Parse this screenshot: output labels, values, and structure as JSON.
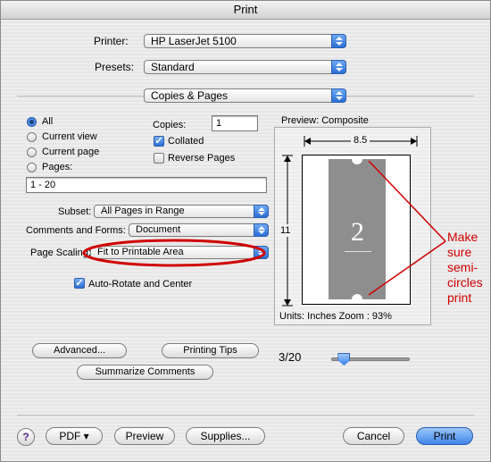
{
  "window": {
    "title": "Print"
  },
  "printer": {
    "label": "Printer:",
    "value": "HP LaserJet 5100"
  },
  "presets": {
    "label": "Presets:",
    "value": "Standard"
  },
  "panel": {
    "value": "Copies & Pages"
  },
  "pages": {
    "all": "All",
    "current_view": "Current view",
    "current_page": "Current page",
    "pages": "Pages:",
    "range_value": "1 - 20",
    "selected": "All"
  },
  "copies": {
    "label": "Copies:",
    "value": "1",
    "collated": "Collated",
    "collated_checked": true,
    "reverse": "Reverse Pages",
    "reverse_checked": false
  },
  "subset": {
    "label": "Subset:",
    "value": "All Pages in Range"
  },
  "comments": {
    "label": "Comments and Forms:",
    "value": "Document"
  },
  "scaling": {
    "label": "Page Scaling:",
    "value": "Fit to Printable Area"
  },
  "autorotate": {
    "label": "Auto-Rotate and Center",
    "checked": true
  },
  "preview": {
    "title": "Preview: Composite",
    "width_label": "8.5",
    "height_label": "11",
    "page_number": "2",
    "units": "Units: Inches Zoom :  93%"
  },
  "buttons": {
    "advanced": "Advanced...",
    "printing_tips": "Printing Tips",
    "summarize": "Summarize Comments",
    "help": "?",
    "pdf": "PDF ▾",
    "preview": "Preview",
    "supplies": "Supplies...",
    "cancel": "Cancel",
    "print": "Print"
  },
  "pager": {
    "text": "3/20",
    "position": 0.1
  },
  "annotation": {
    "lines": [
      "Make",
      "sure",
      "semi-",
      "circles",
      "print"
    ],
    "color": "#d00000"
  },
  "colors": {
    "accent": "#3f86e8",
    "annotation": "#d00000"
  }
}
